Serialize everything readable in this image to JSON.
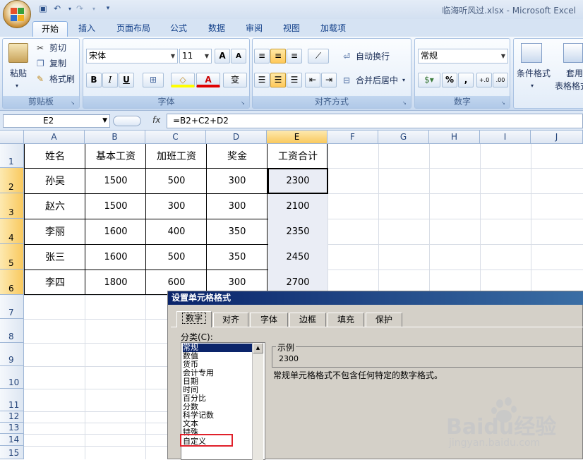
{
  "window": {
    "title": "临海听风过.xlsx - Microsoft Excel"
  },
  "ribbon": {
    "tabs": [
      "开始",
      "插入",
      "页面布局",
      "公式",
      "数据",
      "审阅",
      "视图",
      "加载项"
    ],
    "active_tab": "开始",
    "clipboard": {
      "paste": "粘贴",
      "cut": "剪切",
      "copy": "复制",
      "format_painter": "格式刷",
      "label": "剪贴板"
    },
    "font": {
      "name": "宋体",
      "size": "11",
      "label": "字体",
      "bold": "B",
      "italic": "I",
      "underline": "U",
      "grow": "A",
      "shrink": "A",
      "font_color": "A",
      "phonetic": "变"
    },
    "alignment": {
      "wrap": "自动换行",
      "merge": "合并后居中",
      "label": "对齐方式"
    },
    "number": {
      "format": "常规",
      "percent": "%",
      "comma": ",",
      "label": "数字",
      "increase": "+.0",
      "decrease": ".00"
    },
    "styles": {
      "conditional": "条件格式",
      "table1": "套用",
      "table2": "表格格式"
    }
  },
  "formula_bar": {
    "name_box": "E2",
    "fx": "fx",
    "formula": "=B2+C2+D2"
  },
  "sheet": {
    "columns": [
      "A",
      "B",
      "C",
      "D",
      "E",
      "F",
      "G",
      "H",
      "I",
      "J"
    ],
    "rows": [
      "1",
      "2",
      "3",
      "4",
      "5",
      "6",
      "7",
      "8",
      "9",
      "10",
      "11",
      "12",
      "13",
      "14",
      "15"
    ],
    "header": [
      "姓名",
      "基本工资",
      "加班工资",
      "奖金",
      "工资合计"
    ],
    "data": [
      [
        "孙吴",
        "1500",
        "500",
        "300",
        "2300"
      ],
      [
        "赵六",
        "1500",
        "300",
        "300",
        "2100"
      ],
      [
        "李丽",
        "1600",
        "400",
        "350",
        "2350"
      ],
      [
        "张三",
        "1600",
        "500",
        "350",
        "2450"
      ],
      [
        "李四",
        "1800",
        "600",
        "300",
        "2700"
      ]
    ]
  },
  "dialog": {
    "title": "设置单元格格式",
    "tabs": [
      "数字",
      "对齐",
      "字体",
      "边框",
      "填充",
      "保护"
    ],
    "category_label": "分类(C):",
    "categories": [
      "常规",
      "数值",
      "货币",
      "会计专用",
      "日期",
      "时间",
      "百分比",
      "分数",
      "科学记数",
      "文本",
      "特殊",
      "自定义"
    ],
    "selected_category": "常规",
    "sample_label": "示例",
    "sample_value": "2300",
    "description": "常规单元格格式不包含任何特定的数字格式。"
  },
  "watermark": {
    "brand": "Baidu经验",
    "url": "jingyan.baidu.com"
  },
  "colors": {
    "selection_header": "#f9c95e",
    "red_highlight": "#e0202a",
    "dialog_title": "#0a246a"
  }
}
